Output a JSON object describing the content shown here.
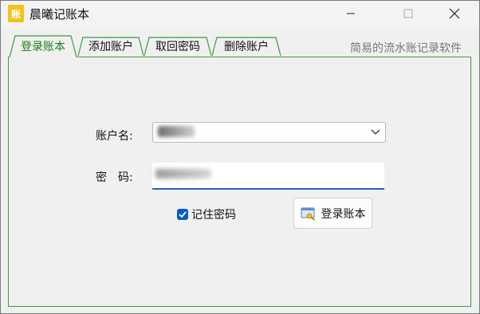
{
  "window": {
    "title": "晨曦记账本",
    "app_icon_glyph": "账"
  },
  "tabs": [
    {
      "label": "登录账本",
      "active": true
    },
    {
      "label": "添加账户",
      "active": false
    },
    {
      "label": "取回密码",
      "active": false
    },
    {
      "label": "删除账户",
      "active": false
    }
  ],
  "tagline": "简易的流水账记录软件",
  "form": {
    "account_label": "账户名:",
    "password_label": "密　码:",
    "remember_label": "记住密码",
    "remember_checked": true,
    "login_button_label": "登录账本"
  },
  "colors": {
    "active_tab_text": "#1a7f1a",
    "panel_border": "#3e9a3e",
    "focus_underline": "#1e63b8",
    "checkbox": "#0a5bc4",
    "app_icon": "#f4c21a"
  }
}
